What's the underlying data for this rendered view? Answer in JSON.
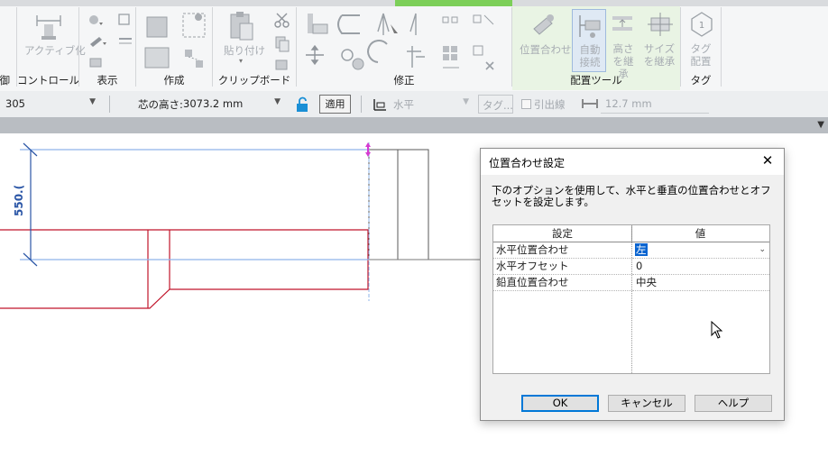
{
  "ribbon": {
    "panels": [
      {
        "label": "制御"
      },
      {
        "label": "コントロール",
        "buttons": [
          {
            "label": "アクティブ化"
          }
        ]
      },
      {
        "label": "表示"
      },
      {
        "label": "作成"
      },
      {
        "label": "クリップボード",
        "buttons": [
          {
            "label": "貼り付け"
          }
        ]
      },
      {
        "label": "修正"
      },
      {
        "label": "配置ツール",
        "buttons": [
          {
            "label": "位置合わせ"
          },
          {
            "label": "自動接続"
          },
          {
            "label": "高さを継承"
          },
          {
            "label": "サイズを継承"
          }
        ]
      },
      {
        "label": "タグ",
        "buttons": [
          {
            "label": "タグ配置"
          }
        ]
      }
    ],
    "colors": {
      "active_tab": "#7ccf59",
      "panel_highlight": "#e9f4e4"
    }
  },
  "options_bar": {
    "size_value": "305",
    "center_height_label": "芯の高さ:",
    "center_height_value": "3073.2 mm",
    "apply_label": "適用",
    "orientation_value": "水平",
    "tag_label": "タグ...",
    "leader_label": "引出線",
    "leader_length": "12.7 mm"
  },
  "canvas": {
    "dimension_text": "550.(",
    "colors": {
      "pipe": "#c0142a",
      "dimension": "#2a55a6",
      "selection": "#8fb5ea",
      "grip": "#d53ad1"
    }
  },
  "dialog": {
    "title": "位置合わせ設定",
    "description": "下のオプションを使用して、水平と垂直の位置合わせとオフセットを設定します。",
    "table": {
      "headers": [
        "設定",
        "値"
      ],
      "rows": [
        {
          "setting": "水平位置合わせ",
          "value": "左"
        },
        {
          "setting": "水平オフセット",
          "value": "0"
        },
        {
          "setting": "鉛直位置合わせ",
          "value": "中央"
        }
      ]
    },
    "buttons": {
      "ok": "OK",
      "cancel": "キャンセル",
      "help": "ヘルプ"
    }
  }
}
